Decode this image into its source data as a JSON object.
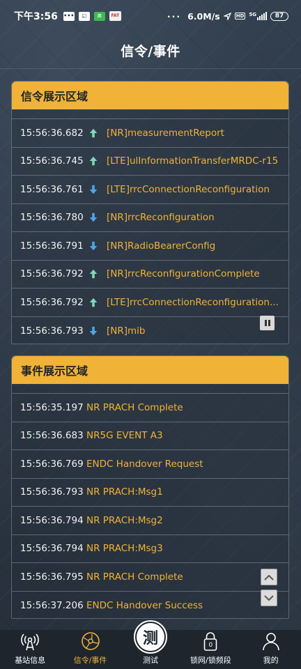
{
  "status_bar": {
    "time": "下午3:56",
    "speed": "6.0M/s",
    "hd": "HD",
    "network": "5G",
    "battery": "87",
    "icons": [
      "message-icon",
      "wechat-work-icon",
      "green-app-icon",
      "fat-app-icon",
      "more-dots-icon",
      "location-icon",
      "hd-icon",
      "signal-icon",
      "battery-icon"
    ]
  },
  "header": {
    "title": "信令/事件"
  },
  "signal_panel": {
    "title": "信令展示区域",
    "rows": [
      {
        "time": "15:56:36.682",
        "direction": "up",
        "message": "[NR]measurementReport"
      },
      {
        "time": "15:56:36.745",
        "direction": "up",
        "message": "[LTE]ulInformationTransferMRDC-r15"
      },
      {
        "time": "15:56:36.761",
        "direction": "down",
        "message": "[LTE]rrcConnectionReconfiguration"
      },
      {
        "time": "15:56:36.780",
        "direction": "down",
        "message": "[NR]rrcReconfiguration"
      },
      {
        "time": "15:56:36.791",
        "direction": "down",
        "message": "[NR]RadioBearerConfig"
      },
      {
        "time": "15:56:36.792",
        "direction": "up",
        "message": "[NR]rrcReconfigurationComplete"
      },
      {
        "time": "15:56:36.792",
        "direction": "up",
        "message": "[LTE]rrcConnectionReconfiguration..."
      },
      {
        "time": "15:56:36.793",
        "direction": "down",
        "message": "[NR]mib"
      }
    ]
  },
  "event_panel": {
    "title": "事件展示区域",
    "rows": [
      {
        "time": "15:56:35.197",
        "message": "NR PRACH Complete"
      },
      {
        "time": "15:56:36.683",
        "message": "NR5G EVENT A3"
      },
      {
        "time": "15:56:36.769",
        "message": "ENDC Handover Request"
      },
      {
        "time": "15:56:36.793",
        "message": "NR PRACH:Msg1"
      },
      {
        "time": "15:56:36.794",
        "message": "NR PRACH:Msg2"
      },
      {
        "time": "15:56:36.794",
        "message": "NR PRACH:Msg3"
      },
      {
        "time": "15:56:36.795",
        "message": "NR PRACH Complete"
      },
      {
        "time": "15:56:37.206",
        "message": "ENDC Handover Success"
      }
    ]
  },
  "bottom_nav": {
    "items": [
      {
        "label": "基站信息",
        "icon": "base-station-icon",
        "active": false
      },
      {
        "label": "信令/事件",
        "icon": "globe-signal-icon",
        "active": true
      },
      {
        "label": "测试",
        "icon": "test-icon",
        "glyph": "测",
        "active": false
      },
      {
        "label": "锁网/锁频段",
        "icon": "lock-icon",
        "badge": "0",
        "active": false
      },
      {
        "label": "我的",
        "icon": "user-icon",
        "active": false
      }
    ]
  },
  "colors": {
    "accent": "#f0b237",
    "arrow_up": "#7fd8b6",
    "arrow_down": "#4ea6e6",
    "background": "#2b3643"
  }
}
